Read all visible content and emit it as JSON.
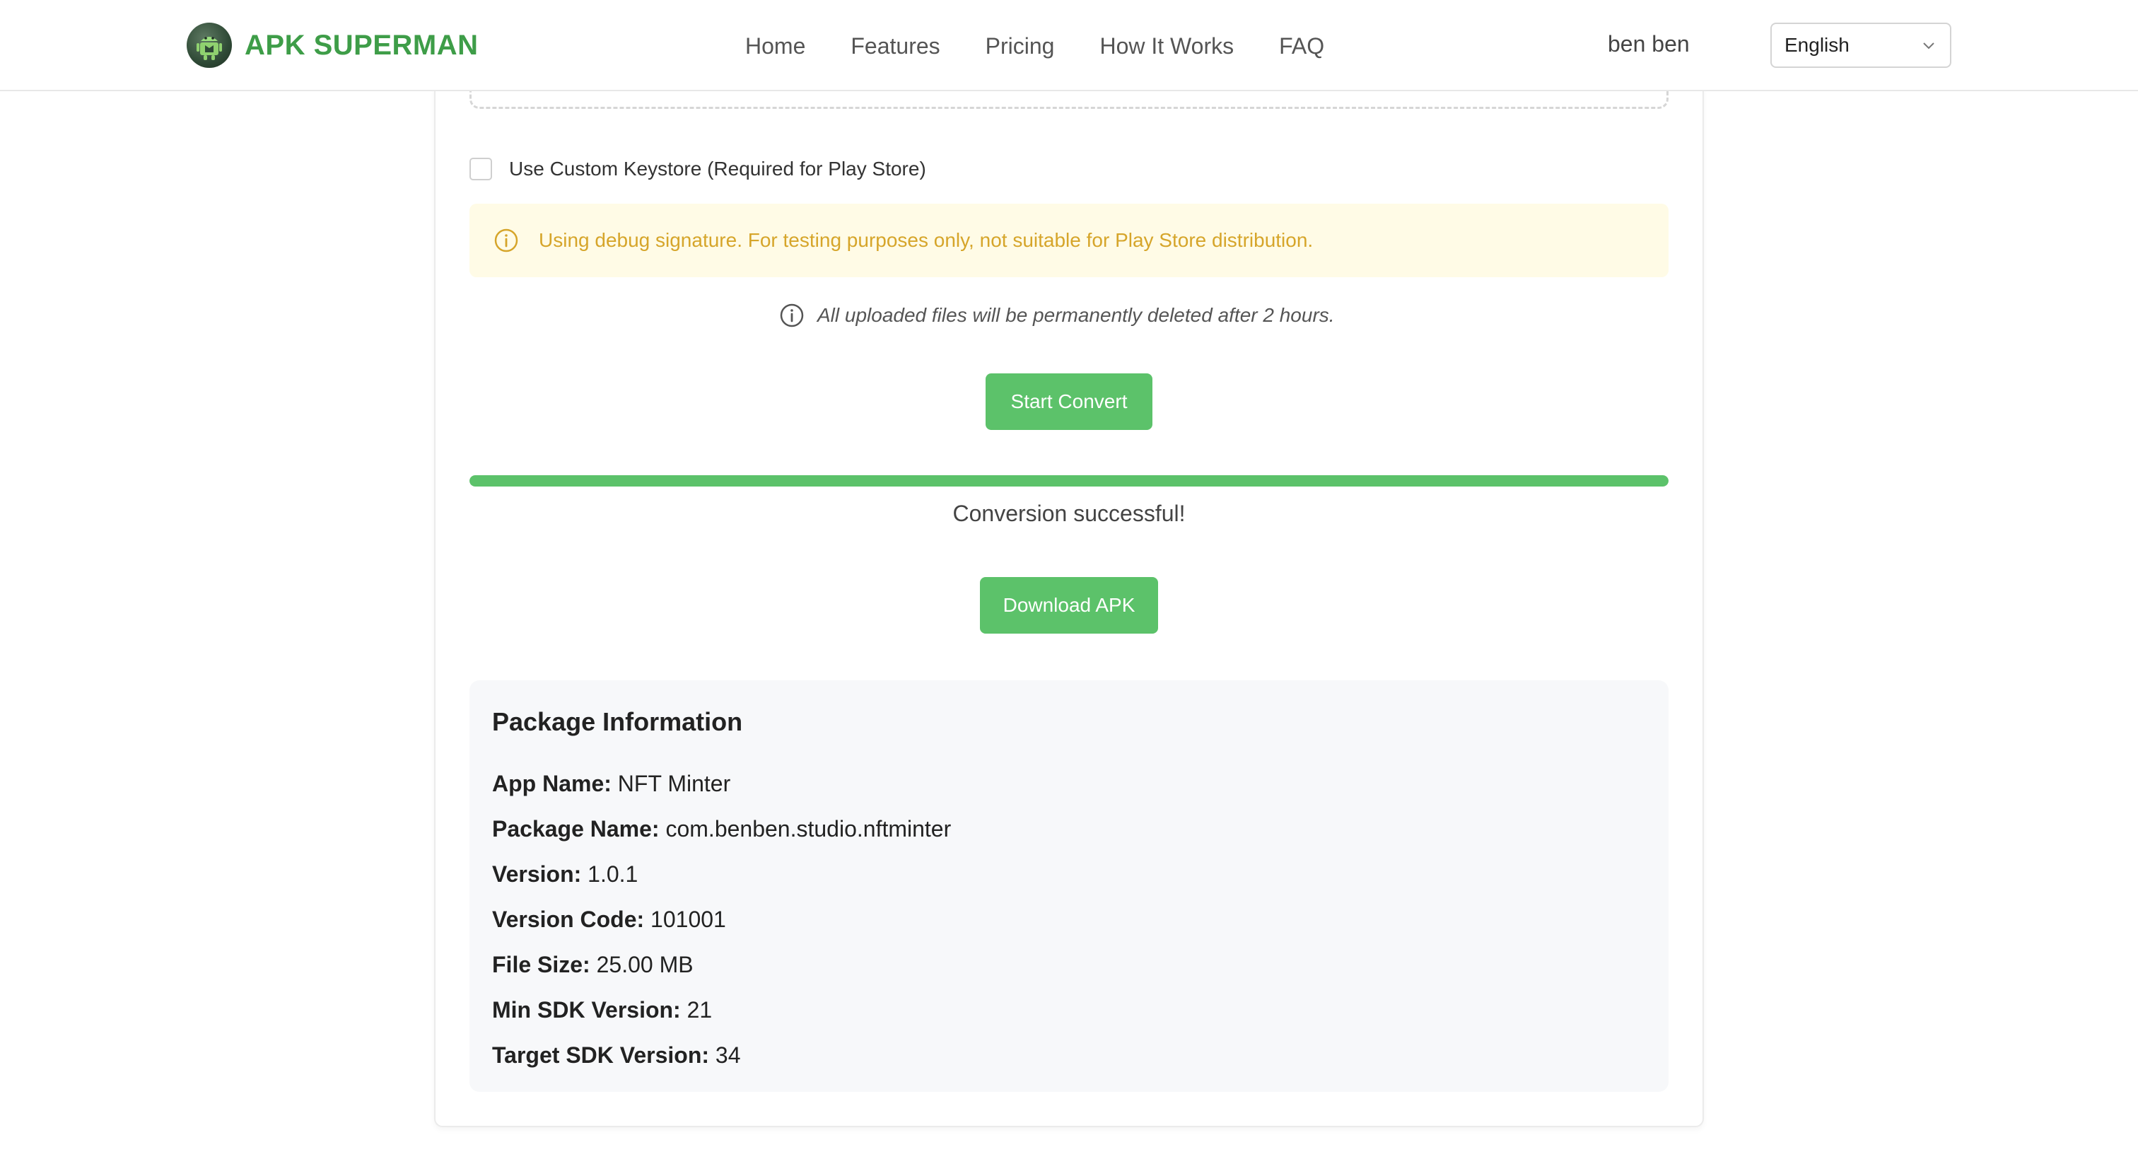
{
  "header": {
    "brand": "APK SUPERMAN",
    "nav": [
      "Home",
      "Features",
      "Pricing",
      "How It Works",
      "FAQ"
    ],
    "user": "ben ben",
    "language": "English"
  },
  "form": {
    "keystore_label": "Use Custom Keystore (Required for Play Store)",
    "keystore_checked": false,
    "warning": "Using debug signature. For testing purposes only, not suitable for Play Store distribution.",
    "notice": "All uploaded files will be permanently deleted after 2 hours.",
    "start_button": "Start Convert",
    "progress_percent": 100,
    "status": "Conversion successful!",
    "download_button": "Download APK"
  },
  "package": {
    "title": "Package Information",
    "rows": [
      {
        "key": "App Name:",
        "value": "NFT Minter"
      },
      {
        "key": "Package Name:",
        "value": "com.benben.studio.nftminter"
      },
      {
        "key": "Version:",
        "value": "1.0.1"
      },
      {
        "key": "Version Code:",
        "value": "101001"
      },
      {
        "key": "File Size:",
        "value": "25.00 MB"
      },
      {
        "key": "Min SDK Version:",
        "value": "21"
      },
      {
        "key": "Target SDK Version:",
        "value": "34"
      }
    ]
  },
  "colors": {
    "brand_green": "#3e9d48",
    "button_green": "#5cc26a",
    "warning_bg": "#fffbe6",
    "warning_text": "#d6a52a"
  }
}
